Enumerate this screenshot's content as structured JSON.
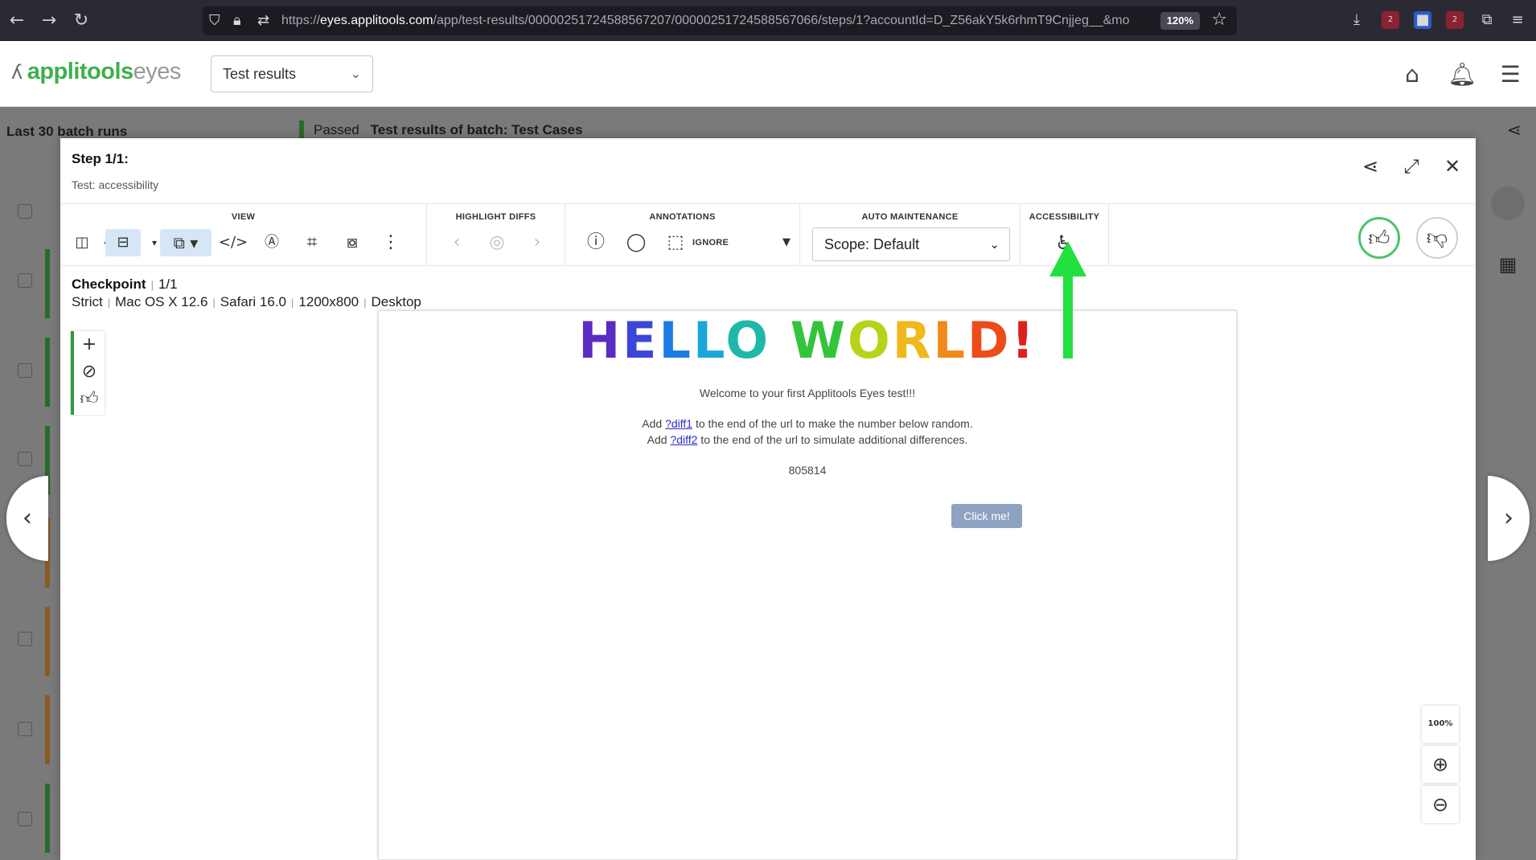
{
  "browser": {
    "url_prefix": "https://",
    "url_host": "eyes.applitools.com",
    "url_path": "/app/test-results/00000251724588567207/00000251724588567066/steps/1?accountId=D_Z56akY5k6rhmT9Cnjjeg__&mo",
    "zoom": "120%",
    "ext_badge_1": "2",
    "ext_badge_2": "2"
  },
  "header": {
    "logo_primary": "applitools",
    "logo_secondary": "eyes",
    "view_select": "Test results"
  },
  "background": {
    "sidebar_title": "Last 30 batch runs",
    "batch_status": "Passed",
    "batch_title": "Test results of batch:  Test Cases"
  },
  "modal": {
    "step_title": "Step 1/1:",
    "test_name": "Test: accessibility"
  },
  "toolbar": {
    "view_label": "VIEW",
    "highlight_label": "HIGHLIGHT DIFFS",
    "annotations_label": "ANNOTATIONS",
    "ignore_label": "IGNORE",
    "auto_label": "AUTO MAINTENANCE",
    "scope": "Scope: Default",
    "accessibility_label": "ACCESSIBILITY"
  },
  "checkpoint": {
    "label": "Checkpoint",
    "count": "1/1",
    "match_level": "Strict",
    "os": "Mac OS X 12.6",
    "browser": "Safari 16.0",
    "viewport": "1200x800",
    "device": "Desktop"
  },
  "canvas": {
    "hello": [
      "H",
      "E",
      "L",
      "L",
      "O",
      " ",
      "W",
      "O",
      "R",
      "L",
      "D",
      "!"
    ],
    "welcome": "Welcome to your first Applitools Eyes test!!!",
    "line1_pre": "Add ",
    "line1_link": "?diff1",
    "line1_post": " to the end of the url to make the number below random.",
    "line2_pre": "Add ",
    "line2_link": "?diff2",
    "line2_post": " to the end of the url to simulate additional differences.",
    "number": "805814",
    "button": "Click me!"
  },
  "zoom_controls": {
    "fit": "100%"
  },
  "colors": {
    "brand_green": "#3db04b",
    "annotation_arrow": "#22e040",
    "approve_ring": "#4cc36a"
  }
}
